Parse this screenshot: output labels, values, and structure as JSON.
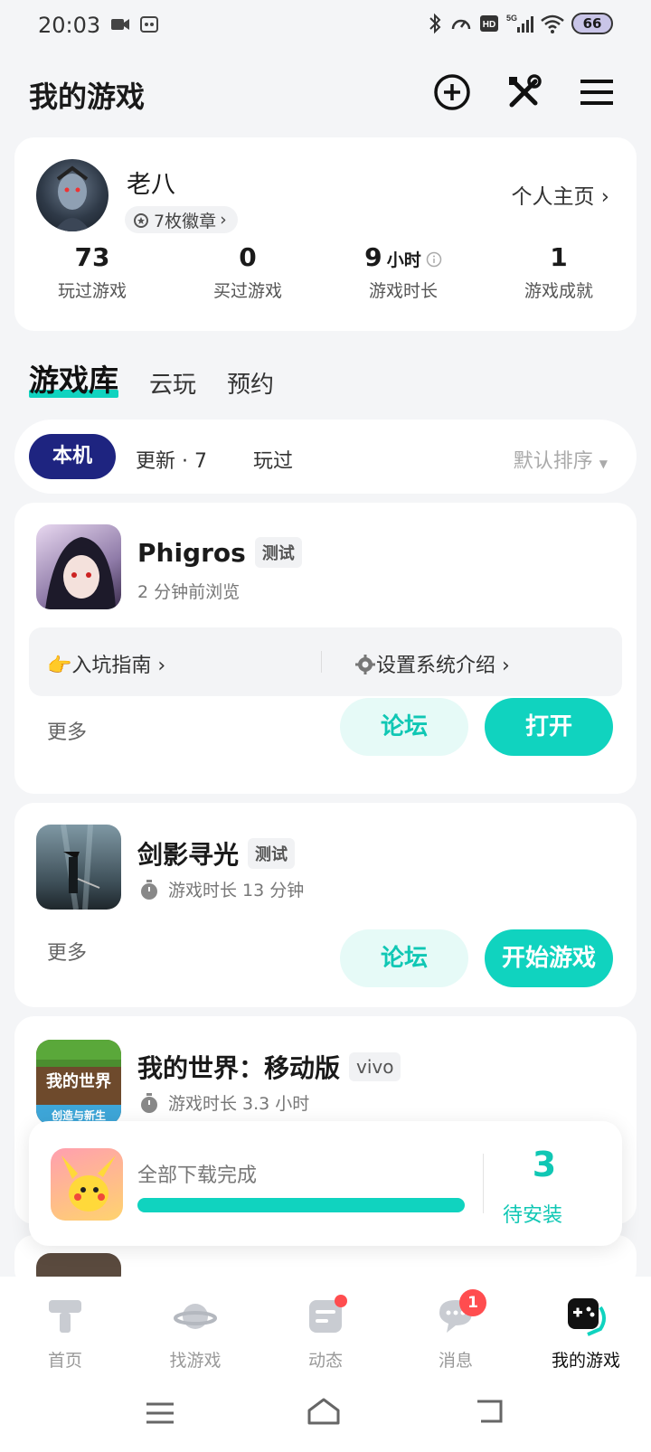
{
  "status_bar": {
    "time": "20:03",
    "battery": "66"
  },
  "header": {
    "title": "我的游戏"
  },
  "profile": {
    "name": "老八",
    "badges": "7枚徽章",
    "homepage_link": "个人主页",
    "stats": [
      {
        "value": "73",
        "unit": "",
        "label": "玩过游戏"
      },
      {
        "value": "0",
        "unit": "",
        "label": "买过游戏"
      },
      {
        "value": "9",
        "unit": "小时",
        "label": "游戏时长"
      },
      {
        "value": "1",
        "unit": "",
        "label": "游戏成就"
      }
    ]
  },
  "tabs": [
    "游戏库",
    "云玩",
    "预约"
  ],
  "filters": {
    "active": "本机",
    "updates": "更新 · 7",
    "played": "玩过",
    "sort": "默认排序"
  },
  "games": [
    {
      "name": "Phigros",
      "tag": "测试",
      "subtitle": "2 分钟前浏览",
      "guide_left": "入坑指南",
      "guide_right": "设置系统介绍",
      "more": "更多",
      "forum": "论坛",
      "action": "打开"
    },
    {
      "name": "剑影寻光",
      "tag": "测试",
      "subtitle": "游戏时长 13 分钟",
      "more": "更多",
      "forum": "论坛",
      "action": "开始游戏"
    },
    {
      "name": "我的世界：移动版",
      "tag": "vivo",
      "subtitle": "游戏时长 3.3 小时",
      "icon_text_top": "我的世界",
      "icon_text_bottom": "创造与新生"
    }
  ],
  "download": {
    "text": "全部下载完成",
    "progress": 1.0,
    "count": "3",
    "label": "待安装"
  },
  "nav": [
    {
      "label": "首页",
      "icon": "home-hammer-icon"
    },
    {
      "label": "找游戏",
      "icon": "planet-icon"
    },
    {
      "label": "动态",
      "icon": "feed-icon"
    },
    {
      "label": "消息",
      "icon": "chat-icon",
      "badge": "1"
    },
    {
      "label": "我的游戏",
      "icon": "gamepad-icon"
    }
  ],
  "colors": {
    "accent": "#10d3bf",
    "navy": "#1e2480",
    "alert": "#ff4d4f"
  }
}
